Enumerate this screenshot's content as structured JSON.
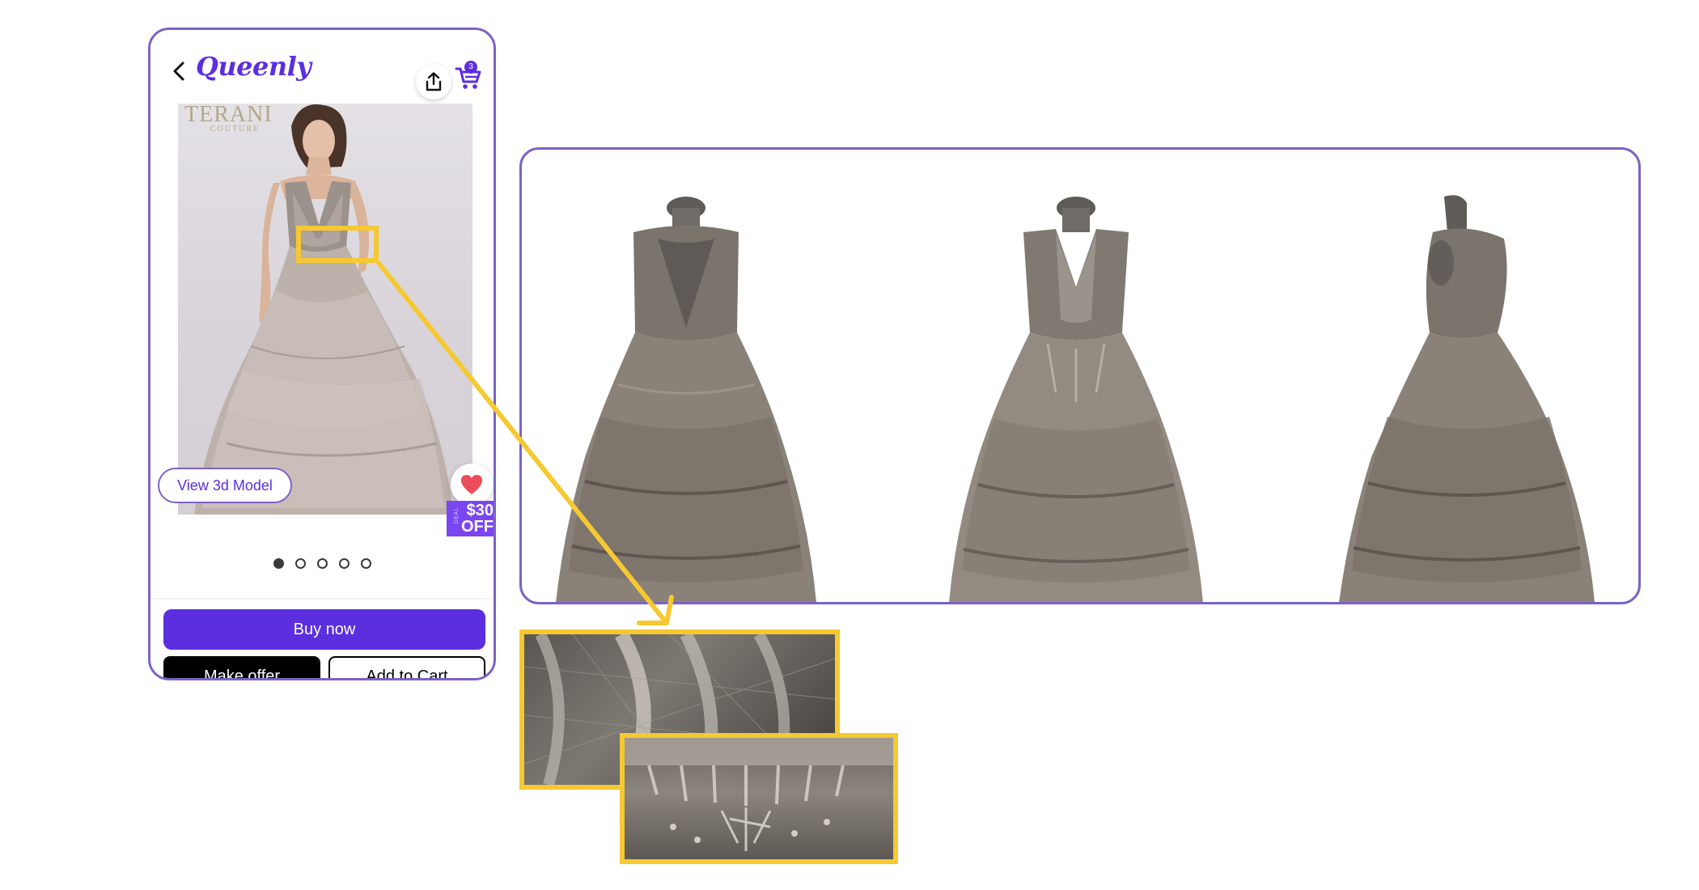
{
  "app": {
    "logo": "Queenly",
    "cart_count": "3"
  },
  "product": {
    "brand_mark": "TERANI",
    "brand_sub": "COUTURE",
    "view_3d_label": "View 3d Model",
    "discount_amount": "$30",
    "discount_suffix": "OFF",
    "discount_tag_text": "DEAL",
    "image_count": 5,
    "active_image_index": 0
  },
  "actions": {
    "buy_now": "Buy now",
    "make_offer": "Make offer",
    "add_to_cart": "Add to Cart"
  },
  "model_views": [
    "back-view",
    "front-view",
    "side-view"
  ],
  "colors": {
    "brand_purple": "#5b2ee0",
    "border_purple": "#7e62c5",
    "highlight_yellow": "#f6c832",
    "sale_purple": "#7b45f2",
    "heart_red": "#ee4c5b"
  }
}
